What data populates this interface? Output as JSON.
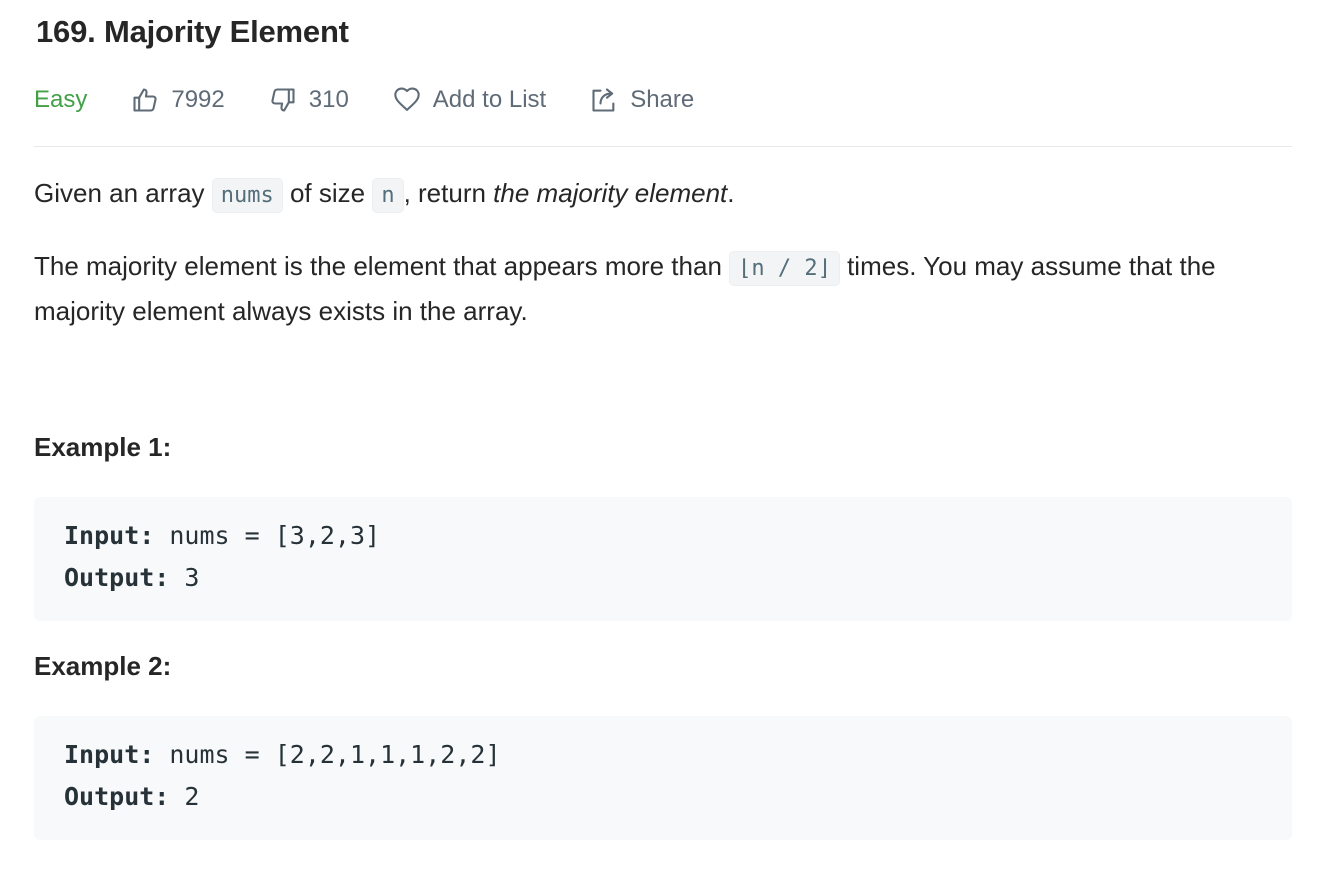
{
  "problem": {
    "title": "169. Majority Element",
    "difficulty": "Easy",
    "likes": "7992",
    "dislikes": "310",
    "add_to_list_label": "Add to List",
    "share_label": "Share"
  },
  "description": {
    "p1": {
      "t1": "Given an array ",
      "code1": "nums",
      "t2": " of size ",
      "code2": "n",
      "t3": ", return ",
      "em": "the majority element",
      "t4": "."
    },
    "p2": {
      "t1": "The majority element is the element that appears more than ",
      "code": "⌊n / 2⌋",
      "t2": " times. You may assume that the majority element always exists in the array."
    }
  },
  "examples": [
    {
      "title": "Example 1:",
      "input_label": "Input:",
      "input_value": " nums = [3,2,3]",
      "output_label": "Output:",
      "output_value": " 3"
    },
    {
      "title": "Example 2:",
      "input_label": "Input:",
      "input_value": " nums = [2,2,1,1,1,2,2]",
      "output_label": "Output:",
      "output_value": " 2"
    }
  ],
  "colors": {
    "easy": "#43a047",
    "meta_text": "#5f6b76",
    "code_bg": "#f7f9fa"
  },
  "icons": [
    "thumbs-up-icon",
    "thumbs-down-icon",
    "heart-icon",
    "share-icon"
  ]
}
